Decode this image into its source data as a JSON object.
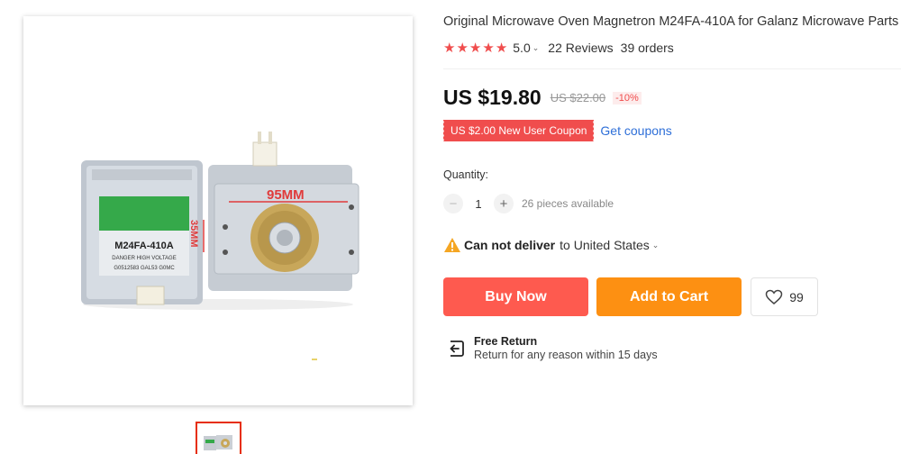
{
  "product": {
    "title": "Original Microwave Oven Magnetron M24FA-410A for Galanz Microwave Parts",
    "rating": "5.0",
    "reviews": "22 Reviews",
    "orders": "39 orders",
    "price": "US $19.80",
    "original_price": "US $22.00",
    "discount": "-10%",
    "coupon": "US $2.00 New User Coupon",
    "get_coupons": "Get coupons"
  },
  "image": {
    "label_model": "M24FA-410A",
    "label_warning": "DANGER HIGH VOLTAGE",
    "label_code": "G0512583 GAL53 G0MC",
    "dim_width": "95MM",
    "dim_height": "35MM"
  },
  "quantity": {
    "label": "Quantity:",
    "value": "1",
    "minus": "−",
    "plus": "+",
    "available": "26 pieces available"
  },
  "delivery": {
    "status": "Can not deliver",
    "destination": "to United States"
  },
  "actions": {
    "buy_now": "Buy Now",
    "add_to_cart": "Add to Cart",
    "wishlist_count": "99"
  },
  "return_policy": {
    "title": "Free Return",
    "subtitle": "Return for any reason within 15 days"
  },
  "colors": {
    "accent_red": "#fe5a4f",
    "accent_orange": "#fd9012",
    "star": "#f04d4d",
    "link": "#2e6fd8"
  },
  "icons": [
    "star-icon",
    "chevron-down-icon",
    "warning-icon",
    "heart-icon",
    "return-icon"
  ]
}
